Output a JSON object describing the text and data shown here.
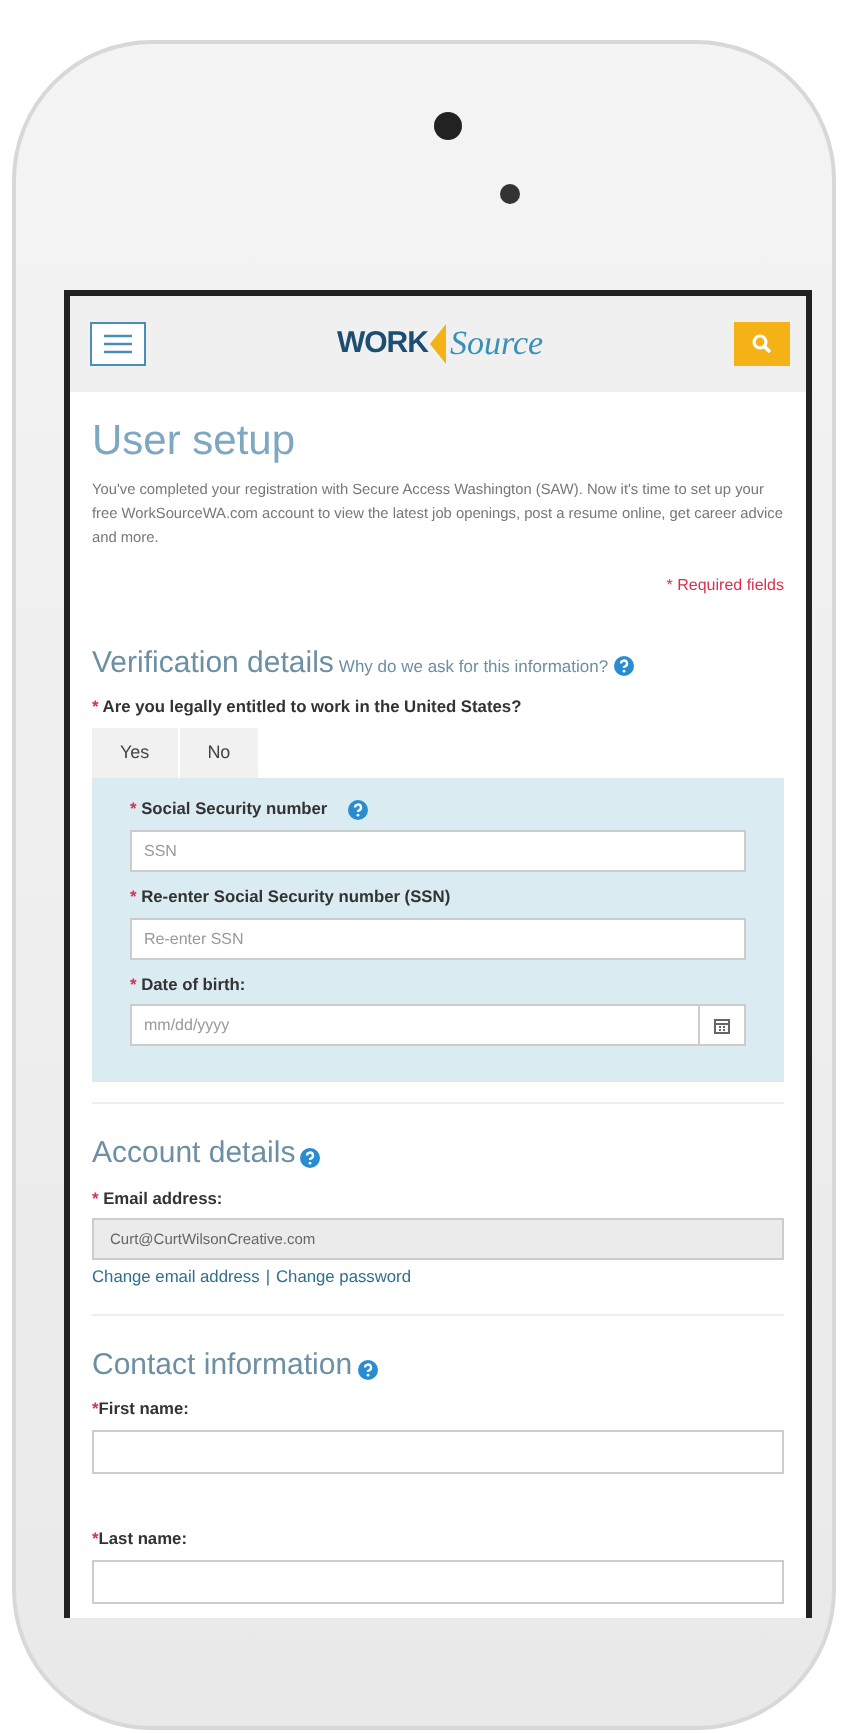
{
  "header": {
    "logo": {
      "first": "WORK",
      "second": "Source"
    }
  },
  "title": "User setup",
  "intro": "You've completed your registration with Secure Access Washington (SAW). Now it's time to set up your free WorkSourceWA.com account to view the latest job openings, post a resume online, get career advice and more.",
  "required_note": {
    "mark": "*",
    "text": "Required fields"
  },
  "verification": {
    "heading": "Verification details",
    "help_link": "Why do we ask for this information?",
    "question": {
      "mark": "*",
      "text": "Are you legally entitled to work in the United States?"
    },
    "options": [
      {
        "label": "Yes",
        "selected": false
      },
      {
        "label": "No",
        "selected": false
      }
    ],
    "fields": [
      {
        "kind": "text",
        "mark": "*",
        "label": "Social Security number",
        "help": true,
        "placeholder": "SSN"
      },
      {
        "kind": "text",
        "mark": "*",
        "label": "Re-enter Social Security number (SSN)",
        "help": false,
        "placeholder": "Re-enter SSN"
      },
      {
        "kind": "date",
        "mark": "*",
        "label": "Date of birth:",
        "help": false,
        "placeholder": "mm/dd/yyyy"
      }
    ]
  },
  "account": {
    "heading": "Account details",
    "email_label": {
      "mark": "*",
      "text": "Email address:"
    },
    "email_value": "Curt@CurtWilsonCreative.com",
    "links": [
      {
        "label": "Change email address"
      },
      {
        "label": "Change password"
      }
    ],
    "separator": "|"
  },
  "contact": {
    "heading": "Contact information",
    "fields": [
      {
        "mark": "*",
        "label": "First name:"
      },
      {
        "mark": "*",
        "label": "Last name:"
      }
    ]
  }
}
